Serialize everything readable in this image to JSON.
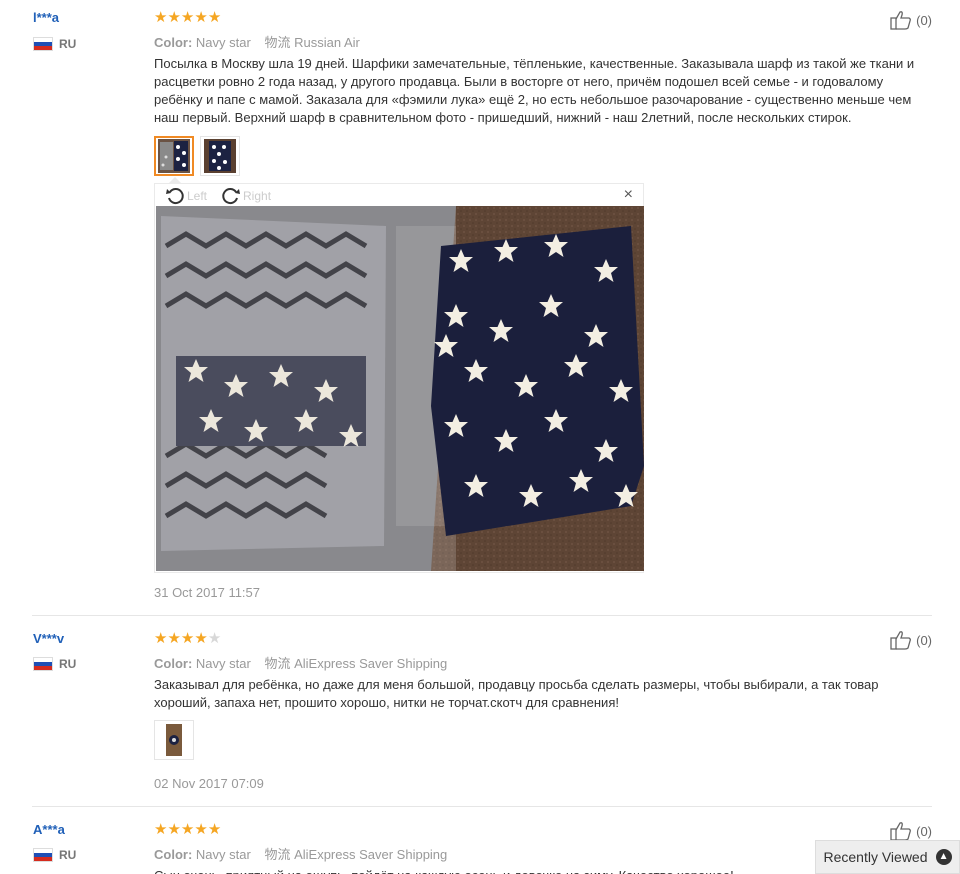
{
  "reviews": [
    {
      "user": "l***a",
      "country": "RU",
      "rating": 5,
      "color_label": "Color:",
      "color_value": "Navy star",
      "logistics_label": "物流",
      "logistics_value": "Russian Air",
      "text": "Посылка в Москву шла 19 дней. Шарфики замечательные, тёпленькие, качественные. Заказывала шарф из такой же ткани и расцветки ровно 2 года назад, у другого продавца. Были в восторге от него, причём подошел всей семье - и годовалому ребёнку и папе с мамой. Заказала для «фэмили лука» ещё 2, но есть небольшое разочарование - существенно меньше чем наш первый. Верхний шарф в сравнительном фото - пришедший, нижний - наш 2летний, после нескольких стирок.",
      "date": "31 Oct 2017 11:57",
      "helpful": "(0)",
      "viewer": {
        "left_label": "Left",
        "right_label": "Right",
        "close": "×"
      }
    },
    {
      "user": "V***v",
      "country": "RU",
      "rating": 4,
      "color_label": "Color:",
      "color_value": "Navy star",
      "logistics_label": "物流",
      "logistics_value": "AliExpress Saver Shipping",
      "text": "Заказывал для ребёнка, но даже для меня большой, продавцу просьба сделать размеры, чтобы выбирали, а так товар хороший, запаха нет, прошито хорошо, нитки не торчат.скотч для сравнения!",
      "date": "02 Nov 2017 07:09",
      "helpful": "(0)"
    },
    {
      "user": "A***a",
      "country": "RU",
      "rating": 5,
      "color_label": "Color:",
      "color_value": "Navy star",
      "logistics_label": "物流",
      "logistics_value": "AliExpress Saver Shipping",
      "text": "Сын очень, приятный на ощупь, пойдёт на каждую осень и девочке на зиму. Качество хорошее!",
      "helpful": "(0)"
    }
  ],
  "recently_viewed": "Recently Viewed",
  "colors": {
    "star": "#f5a623",
    "user": "#2060b8",
    "accent": "#f08a24"
  }
}
